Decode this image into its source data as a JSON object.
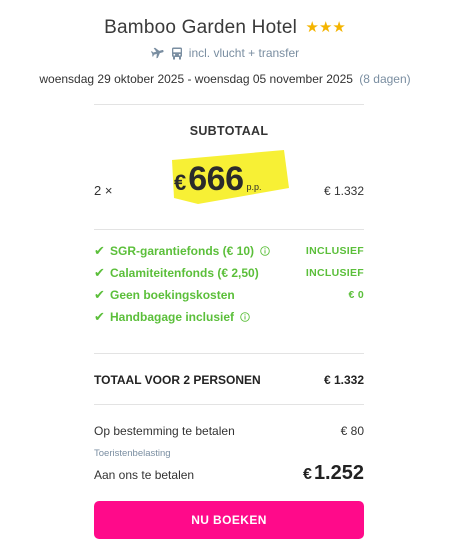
{
  "hotel": {
    "name": "Bamboo Garden Hotel",
    "stars": "★★★",
    "rating_stars": 3,
    "includes_text": "incl. vlucht + transfer",
    "dates_text": "woensdag 29 oktober 2025 - woensdag 05 november 2025",
    "nights_text": "(8 dagen)"
  },
  "subtotal": {
    "label": "SUBTOTAAL",
    "quantity": "2 ×",
    "currency": "€",
    "price_per_person": "666",
    "per_person_suffix": "p.p.",
    "line_total": "€ 1.332"
  },
  "perks": [
    {
      "label": "SGR-garantiefonds  (€ 10)",
      "value": "INCLUSIEF",
      "has_info": true
    },
    {
      "label": "Calamiteitenfonds  (€ 2,50)",
      "value": "INCLUSIEF",
      "has_info": false
    },
    {
      "label": "Geen boekingskosten",
      "value": "€ 0",
      "has_info": false
    },
    {
      "label": "Handbagage inclusief",
      "value": "",
      "has_info": true
    }
  ],
  "total": {
    "label": "TOTAAL VOOR 2 PERSONEN",
    "value": "€ 1.332"
  },
  "payment": {
    "destination_label": "Op bestemming te betalen",
    "destination_value": "€ 80",
    "tourist_tax": "Toeristenbelasting",
    "pay_us_label": "Aan ons te betalen",
    "pay_us_currency": "€",
    "pay_us_value": "1.252"
  },
  "cta": {
    "label": "NU BOEKEN"
  },
  "colors": {
    "accent_pink": "#ff0a8a",
    "green": "#5bbf3a",
    "star_gold": "#f4b400",
    "highlight_yellow": "#f7ef2a",
    "muted_blue": "#7a8ea1"
  },
  "icons": [
    "plane-icon",
    "bus-icon",
    "check-icon",
    "info-icon"
  ]
}
